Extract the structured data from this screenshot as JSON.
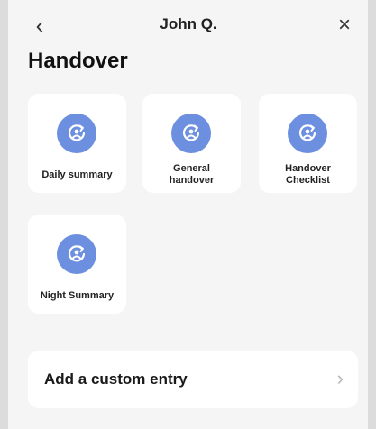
{
  "header": {
    "back_glyph": "‹",
    "title": "John Q.",
    "close_glyph": "×"
  },
  "page": {
    "title": "Handover"
  },
  "tiles": [
    {
      "label": "Daily summary",
      "icon": "refresh-person-icon"
    },
    {
      "label": "General\nhandover",
      "icon": "refresh-person-icon"
    },
    {
      "label": "Handover\nChecklist",
      "icon": "refresh-person-icon"
    },
    {
      "label": "Night Summary",
      "icon": "refresh-person-icon"
    }
  ],
  "custom_entry": {
    "label": "Add a custom entry",
    "chevron": "›"
  },
  "colors": {
    "accent": "#6d8fe0",
    "background": "#f5f5f5",
    "card": "#ffffff"
  }
}
